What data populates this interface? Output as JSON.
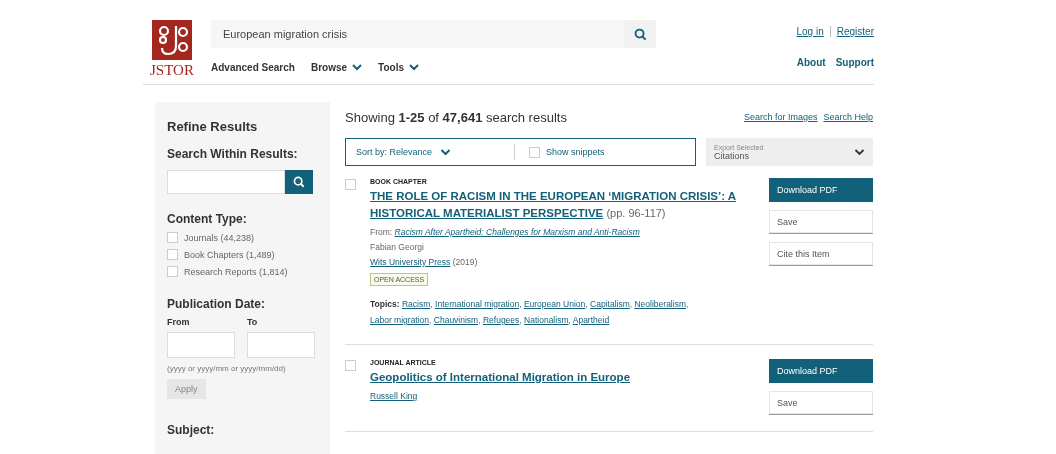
{
  "header": {
    "logo_text": "JSTOR",
    "search": {
      "value": "European migration crisis"
    },
    "nav": [
      {
        "label": "Advanced Search",
        "dropdown": false
      },
      {
        "label": "Browse",
        "dropdown": true
      },
      {
        "label": "Tools",
        "dropdown": true
      }
    ],
    "account_links": [
      "Log in",
      "Register"
    ],
    "info_links": [
      "About",
      "Support"
    ]
  },
  "sidebar": {
    "title": "Refine Results",
    "search_within": {
      "label": "Search Within Results:"
    },
    "content_type": {
      "label": "Content Type:",
      "options": [
        {
          "label": "Journals (44,238)",
          "checked": false
        },
        {
          "label": "Book Chapters (1,489)",
          "checked": false
        },
        {
          "label": "Research Reports (1,814)",
          "checked": false
        }
      ]
    },
    "publication_date": {
      "label": "Publication Date:",
      "from_label": "From",
      "to_label": "To",
      "hint": "(yyyy or yyyy/mm or yyyy/mm/dd)",
      "apply": "Apply"
    },
    "subject": {
      "label": "Subject:"
    }
  },
  "results": {
    "summary": "Showing **1-25** of **47,641** search results",
    "links": [
      "Search for Images",
      "Search Help"
    ],
    "sort": "Sort by: Relevance",
    "show_snippets": {
      "label": "Show snippets",
      "checked": false
    },
    "export": {
      "label": "Export Selected",
      "value": "Citations"
    },
    "items": [
      {
        "selected": false,
        "type": "BOOK CHAPTER",
        "title": "THE ROLE OF RACISM IN THE EUROPEAN ‘MIGRATION CRISIS’: A HISTORICAL MATERIALIST PERSPECTIVE",
        "pages": "(pp. 96-117)",
        "from_label": "From:",
        "source": "Racism After Apartheid: Challenges for Marxism and Anti-Racism",
        "authors": [
          {
            "name": "Fabian Georgi",
            "link": false
          }
        ],
        "publisher": "Wits University Press",
        "year": "(2019)",
        "open_access": true,
        "badge": "OPEN ACCESS",
        "topics_label": "Topics:",
        "topic_separator": ",",
        "topics": [
          "Racism",
          "International migration",
          "European Union",
          "Capitalism",
          "Neoliberalism",
          "Labor migration",
          "Chauvinism",
          "Refugees",
          "Nationalism",
          "Apartheid"
        ],
        "actions": [
          "Download PDF",
          "Save",
          "Cite this Item"
        ]
      },
      {
        "selected": false,
        "type": "JOURNAL ARTICLE",
        "title": "Geopolitics of International Migration in Europe",
        "authors": [
          {
            "name": "Russell King",
            "link": true
          }
        ],
        "open_access": false,
        "actions": [
          "Download PDF",
          "Save"
        ]
      }
    ]
  }
}
